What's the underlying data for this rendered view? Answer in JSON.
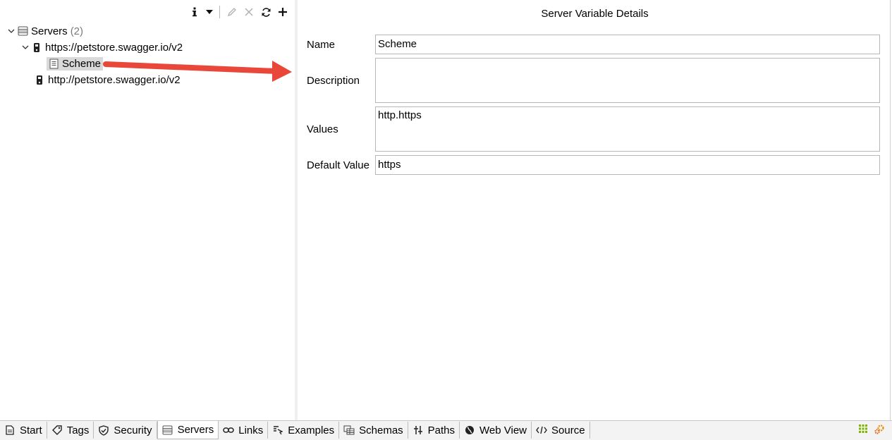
{
  "toolbar": {
    "icons": [
      "info-icon",
      "dropdown-icon",
      "edit-icon",
      "delete-icon",
      "refresh-icon",
      "add-icon"
    ]
  },
  "tree": {
    "root": {
      "label": "Servers",
      "count": "(2)"
    },
    "server1": {
      "label": "https://petstore.swagger.io/v2"
    },
    "variable": {
      "label": "Scheme"
    },
    "server2": {
      "label": "http://petstore.swagger.io/v2"
    }
  },
  "details": {
    "title": "Server Variable Details",
    "name_label": "Name",
    "name_value": "Scheme",
    "description_label": "Description",
    "description_value": "",
    "values_label": "Values",
    "values_value": "http.https",
    "default_label": "Default Value",
    "default_value": "https"
  },
  "tabs": [
    {
      "label": "Start",
      "icon": "document-icon"
    },
    {
      "label": "Tags",
      "icon": "tag-icon"
    },
    {
      "label": "Security",
      "icon": "shield-icon"
    },
    {
      "label": "Servers",
      "icon": "server-icon",
      "active": true
    },
    {
      "label": "Links",
      "icon": "link-icon"
    },
    {
      "label": "Examples",
      "icon": "examples-icon"
    },
    {
      "label": "Schemas",
      "icon": "schemas-icon"
    },
    {
      "label": "Paths",
      "icon": "paths-icon"
    },
    {
      "label": "Web View",
      "icon": "globe-icon"
    },
    {
      "label": "Source",
      "icon": "code-icon"
    }
  ],
  "colors": {
    "arrow": "#e8473a",
    "selection": "#d9d9d9",
    "status_green": "#7ab800",
    "status_orange": "#f08a00"
  }
}
